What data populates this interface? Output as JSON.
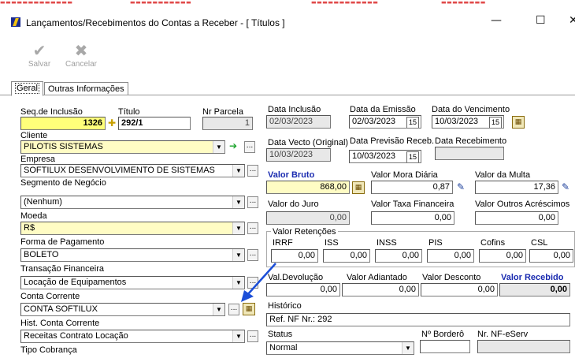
{
  "window": {
    "title": "Lançamentos/Recebimentos do Contas a Receber  - [ Títulos ]",
    "minimize": "—",
    "maximize": "☐",
    "close": "✕"
  },
  "toolbar": {
    "save_label": "Salvar",
    "cancel_label": "Cancelar"
  },
  "tabs": [
    {
      "label": "Geral"
    },
    {
      "label": "Outras Informações"
    }
  ],
  "left": {
    "seq_label": "Seq.de Inclusão",
    "seq_value": "1326",
    "titulo_label": "Título",
    "titulo_value": "292/1",
    "parcela_label": "Nr Parcela",
    "parcela_value": "1",
    "cliente_label": "Cliente",
    "cliente_value": "PILOTIS SISTEMAS",
    "empresa_label": "Empresa",
    "empresa_value": "SOFTILUX DESENVOLVIMENTO DE SISTEMAS",
    "segmento_label": "Segmento de Negócio",
    "segmento_value": "(Nenhum)",
    "moeda_label": "Moeda",
    "moeda_value": "R$",
    "forma_label": "Forma de Pagamento",
    "forma_value": "BOLETO",
    "transacao_label": "Transação Financeira",
    "transacao_value": "Locação de Equipamentos",
    "conta_label": "Conta Corrente",
    "conta_value": "CONTA SOFTILUX",
    "hist_conta_label": "Hist. Conta Corrente",
    "hist_conta_value": "Receitas Contrato Locação",
    "tipo_cobranca_label": "Tipo Cobrança"
  },
  "right": {
    "data_inclusao_label": "Data Inclusão",
    "data_inclusao_value": "02/03/2023",
    "data_emissao_label": "Data da Emissão",
    "data_emissao_value": "02/03/2023",
    "data_vencimento_label": "Data do Vencimento",
    "data_vencimento_value": "10/03/2023",
    "data_vecto_orig_label": "Data Vecto (Original)",
    "data_vecto_orig_value": "10/03/2023",
    "data_prev_label": "Data Previsão Receb.",
    "data_prev_value": "10/03/2023",
    "data_receb_label": "Data Recebimento",
    "valor_bruto_label": "Valor Bruto",
    "valor_bruto_value": "868,00",
    "mora_label": "Valor Mora Diária",
    "mora_value": "0,87",
    "multa_label": "Valor da Multa",
    "multa_value": "17,36",
    "juro_label": "Valor do Juro",
    "juro_value": "0,00",
    "taxa_label": "Valor Taxa Financeira",
    "taxa_value": "0,00",
    "outros_label": "Valor Outros Acréscimos",
    "outros_value": "0,00",
    "retencoes_label": "Valor Retenções",
    "ret": [
      {
        "label": "IRRF",
        "value": "0,00"
      },
      {
        "label": "ISS",
        "value": "0,00"
      },
      {
        "label": "INSS",
        "value": "0,00"
      },
      {
        "label": "PIS",
        "value": "0,00"
      },
      {
        "label": "Cofins",
        "value": "0,00"
      },
      {
        "label": "CSL",
        "value": "0,00"
      }
    ],
    "devolucao_label": "Val.Devolução",
    "devolucao_value": "0,00",
    "adiantado_label": "Valor Adiantado",
    "adiantado_value": "0,00",
    "desconto_label": "Valor Desconto",
    "desconto_value": "0,00",
    "recebido_label": "Valor Recebido",
    "recebido_value": "0,00",
    "historico_label": "Histórico",
    "historico_value": "Ref. NF Nr.: 292",
    "status_label": "Status",
    "status_value": "Normal",
    "bordero_label": "Nº Borderô",
    "nfe_label": "Nr. NF-eServ"
  },
  "colors": {
    "accent_label": "#1a2bb0",
    "yellow_field": "#fffcc4",
    "highlight_field": "#ffff7a",
    "arrow": "#1c4fd8"
  }
}
